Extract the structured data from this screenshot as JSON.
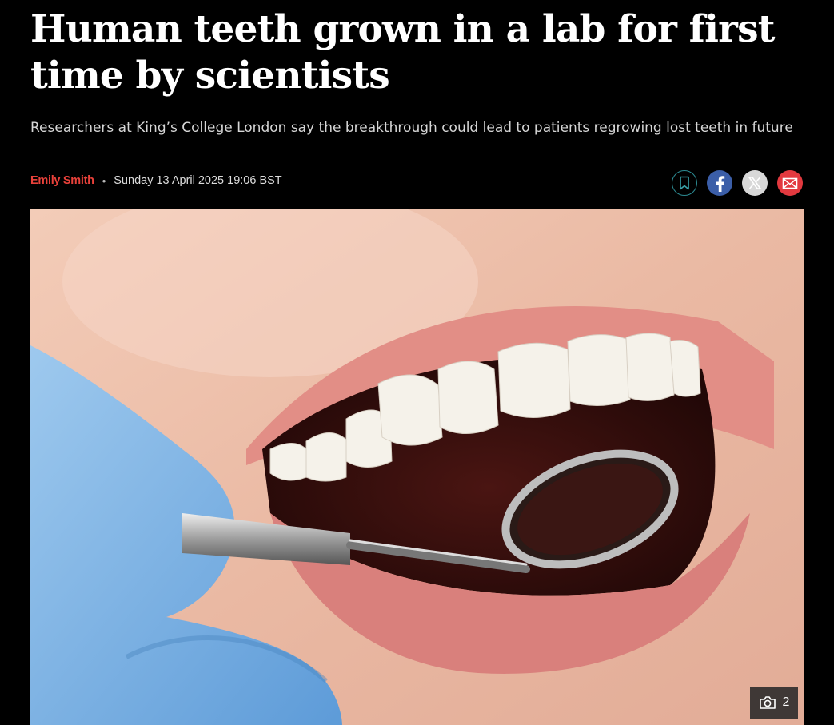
{
  "article": {
    "headline": "Human teeth grown in a lab for first time by scientists",
    "standfirst": "Researchers at King’s College London say the breakthrough could lead to patients regrowing lost teeth in future",
    "author": "Emily Smith",
    "separator": "•",
    "date": "Sunday 13 April 2025 19:06 BST"
  },
  "share": {
    "icons": [
      "bookmark-icon",
      "facebook-icon",
      "x-icon",
      "email-icon"
    ]
  },
  "image": {
    "gallery_count": "2",
    "camera_icon": "camera-icon"
  },
  "colors": {
    "background": "#000000",
    "author": "#e8413a",
    "bookmark_ring": "#2d8c94",
    "facebook": "#3b5ea8",
    "email": "#e2393f"
  }
}
